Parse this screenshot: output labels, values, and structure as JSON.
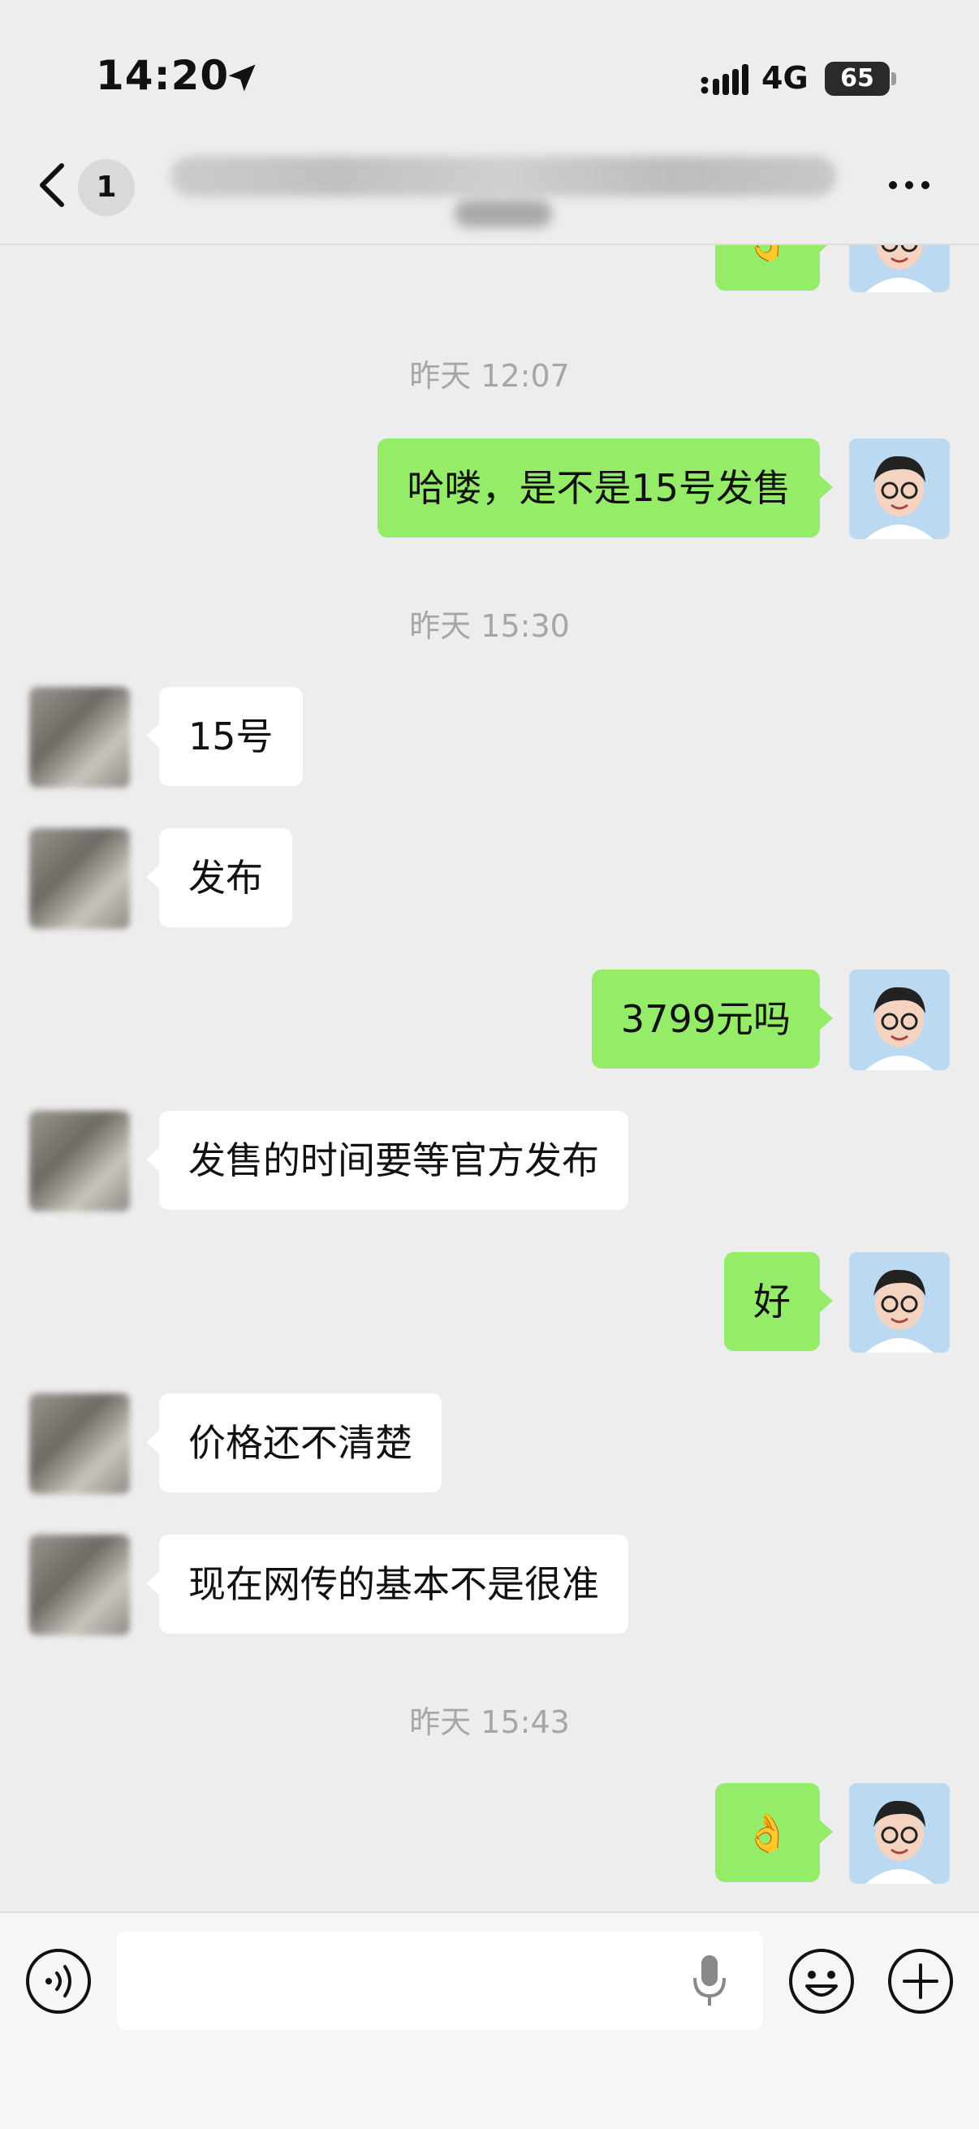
{
  "status_bar": {
    "time": "14:20",
    "network": "4G",
    "battery": "65",
    "icons": [
      "location-arrow-icon",
      "signal-icon"
    ]
  },
  "nav": {
    "back_icon": "chevron-left-icon",
    "unread_count": "1",
    "more_icon": "more-icon"
  },
  "messages": [
    {
      "type": "out",
      "text": "👌"
    },
    {
      "type": "time",
      "text": "昨天 12:07"
    },
    {
      "type": "out",
      "text": "哈喽，是不是15号发售"
    },
    {
      "type": "time",
      "text": "昨天 15:30"
    },
    {
      "type": "in",
      "text": "15号"
    },
    {
      "type": "in",
      "text": "发布"
    },
    {
      "type": "out",
      "text": "3799元吗"
    },
    {
      "type": "in",
      "text": "发售的时间要等官方发布"
    },
    {
      "type": "out",
      "text": "好"
    },
    {
      "type": "in",
      "text": "价格还不清楚"
    },
    {
      "type": "in",
      "text": "现在网传的基本不是很准"
    },
    {
      "type": "time",
      "text": "昨天 15:43"
    },
    {
      "type": "out",
      "text": "👌"
    }
  ],
  "input_bar": {
    "placeholder": "",
    "icons": [
      "voice-icon",
      "mic-icon",
      "emoji-icon",
      "plus-icon"
    ]
  },
  "colors": {
    "background": "#ededed",
    "outgoing_bubble": "#95ec69",
    "incoming_bubble": "#ffffff",
    "timestamp": "#a6a6a6"
  }
}
